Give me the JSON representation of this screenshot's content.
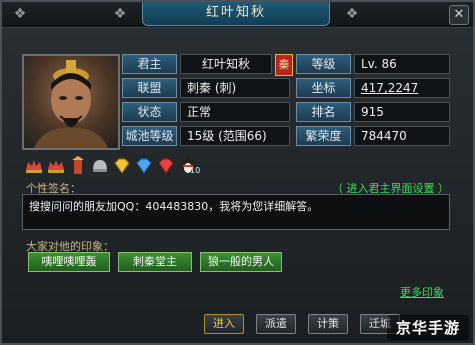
{
  "window": {
    "title": "红叶知秋",
    "close_glyph": "✕"
  },
  "profile": {
    "rows": [
      {
        "label": "君主",
        "value": "红叶知秋",
        "label2": "等级",
        "value2": "Lv. 86"
      },
      {
        "label": "联盟",
        "value": "刺秦 (刺)",
        "label2": "坐标",
        "value2": "417,2247"
      },
      {
        "label": "状态",
        "value": "正常",
        "label2": "排名",
        "value2": "915"
      },
      {
        "label": "城池等级",
        "value": "15级 (范围66)",
        "label2": "繁荣度",
        "value2": "784470"
      }
    ],
    "nation_seal": "秦"
  },
  "badges": [
    {
      "icon": "crown-badge-icon",
      "num": ""
    },
    {
      "icon": "crown-badge-icon",
      "num": ""
    },
    {
      "icon": "tower-badge-icon",
      "num": ""
    },
    {
      "icon": "helmet-badge-icon",
      "num": ""
    },
    {
      "icon": "gold-diamond-icon",
      "num": ""
    },
    {
      "icon": "blue-diamond-icon",
      "num": ""
    },
    {
      "icon": "red-diamond-icon",
      "num": ""
    },
    {
      "icon": "penguin-icon",
      "num": "10"
    }
  ],
  "signature": {
    "label": "个性签名：",
    "enter_link": "（ 进入君主界面设置 ）",
    "text": "搜搜问问的朋友加QQ：404483830，我将为您详细解答。"
  },
  "impressions": {
    "label": "大家对他的印象：",
    "tags": [
      "咦哩咦哩轰",
      "刺秦堂主",
      "狼一般的男人"
    ],
    "more_link": "更多印象"
  },
  "actions": [
    "进入",
    "派遣",
    "计策",
    "迁城"
  ],
  "watermark": "京华手游",
  "colors": {
    "title_plate": "#1f5a78",
    "label_bg": "#2f5d7a",
    "tag_green": "#3c8f35",
    "link_green": "#3ddc5a",
    "seal_red": "#b8231d"
  }
}
